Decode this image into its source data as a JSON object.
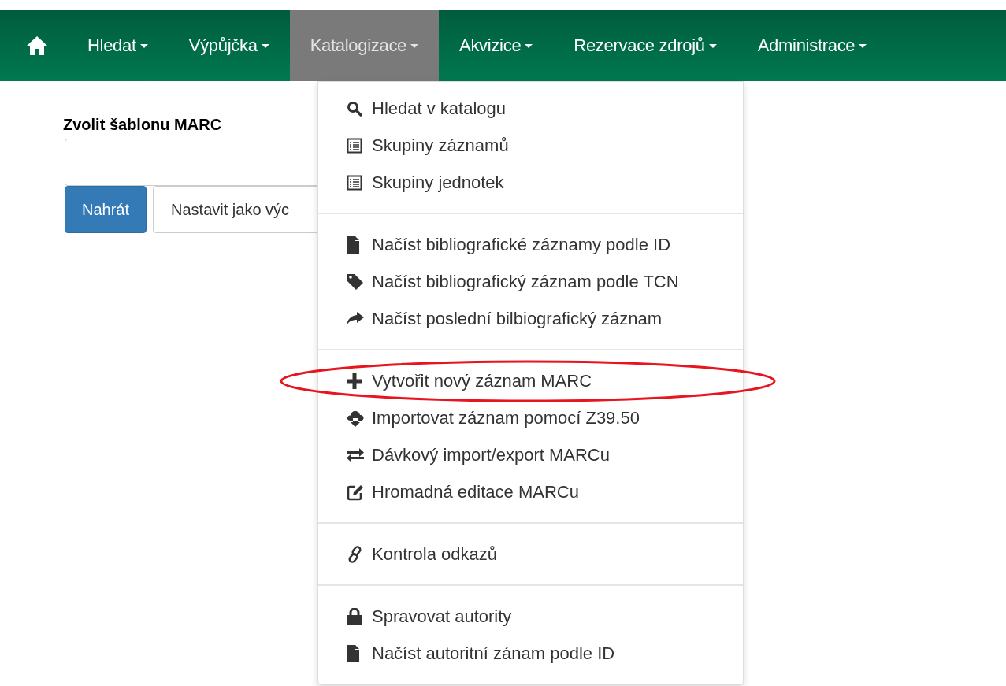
{
  "navbar": {
    "items": [
      {
        "label": "Hledat",
        "selected": false
      },
      {
        "label": "Výpůjčka",
        "selected": false
      },
      {
        "label": "Katalogizace",
        "selected": true
      },
      {
        "label": "Akvizice",
        "selected": false
      },
      {
        "label": "Rezervace zdrojů",
        "selected": false
      },
      {
        "label": "Administrace",
        "selected": false
      }
    ]
  },
  "form": {
    "label": "Zvolit šablonu MARC",
    "buttons": [
      "Nahrát",
      "Nastavit jako výc"
    ]
  },
  "menu": {
    "sections": [
      [
        {
          "label": "Hledat v katalogu",
          "highlighted": false
        },
        {
          "label": "Skupiny záznamů",
          "highlighted": false
        },
        {
          "label": "Skupiny jednotek",
          "highlighted": false
        }
      ],
      [
        {
          "label": "Načíst bibliografické záznamy podle ID",
          "highlighted": false
        },
        {
          "label": "Načíst bibliografický záznam podle TCN",
          "highlighted": false
        },
        {
          "label": "Načíst poslední bilbiografický záznam",
          "highlighted": false
        }
      ],
      [
        {
          "label": "Vytvořit nový záznam MARC",
          "highlighted": true
        },
        {
          "label": "Importovat záznam pomocí Z39.50",
          "highlighted": false
        },
        {
          "label": "Dávkový import/export MARCu",
          "highlighted": false
        },
        {
          "label": "Hromadná editace MARCu",
          "highlighted": false
        }
      ],
      [
        {
          "label": "Kontrola odkazů",
          "highlighted": false
        }
      ],
      [
        {
          "label": "Spravovat autority",
          "highlighted": false
        },
        {
          "label": "Načíst autoritní zánam podle ID",
          "highlighted": false
        }
      ]
    ]
  }
}
